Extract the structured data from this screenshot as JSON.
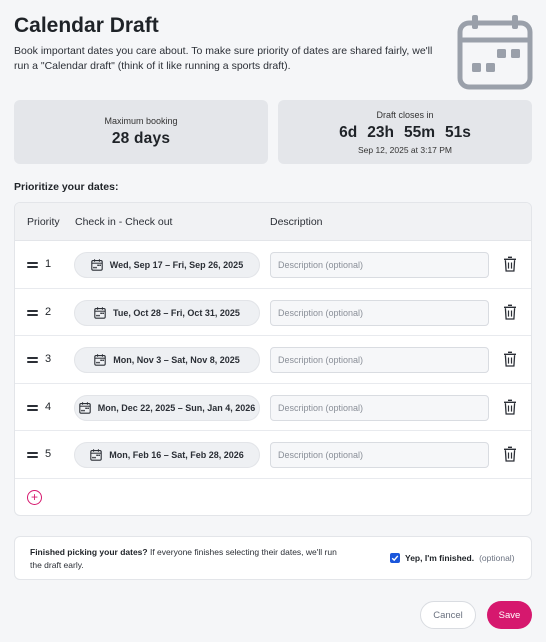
{
  "header": {
    "title": "Calendar Draft",
    "intro": "Book important dates you care about. To make sure priority of dates are shared fairly, we'll run a \"Calendar draft\" (think of it like running a sports draft)."
  },
  "stats": {
    "max_booking_label": "Maximum booking",
    "max_booking_value": "28 days",
    "draft_closes_label": "Draft closes in",
    "countdown": {
      "days": "6d",
      "hours": "23h",
      "minutes": "55m",
      "seconds": "51s"
    },
    "draft_closes_date": "Sep 12, 2025 at 3:17 PM"
  },
  "section_title": "Prioritize your dates:",
  "table": {
    "headers": {
      "priority": "Priority",
      "dates": "Check in - Check out",
      "description": "Description"
    },
    "desc_placeholder": "Description (optional)",
    "rows": [
      {
        "priority": "1",
        "dates": "Wed, Sep 17 – Fri, Sep 26, 2025"
      },
      {
        "priority": "2",
        "dates": "Tue, Oct 28 – Fri, Oct 31, 2025"
      },
      {
        "priority": "3",
        "dates": "Mon, Nov 3 – Sat, Nov 8, 2025"
      },
      {
        "priority": "4",
        "dates": "Mon, Dec 22, 2025 – Sun, Jan 4, 2026"
      },
      {
        "priority": "5",
        "dates": "Mon, Feb 16 – Sat, Feb 28, 2026"
      }
    ],
    "add_icon": "+"
  },
  "finish": {
    "bold": "Finished picking your dates?",
    "text": " If everyone finishes selecting their dates, we'll run the draft early.",
    "checkbox_checked": true,
    "checkbox_label": "Yep, I'm finished.",
    "checkbox_optional": "(optional)"
  },
  "actions": {
    "cancel": "Cancel",
    "save": "Save"
  },
  "colors": {
    "accent": "#d6186e",
    "checkbox": "#1a56db",
    "card": "#e4e6ea",
    "page": "#f5f6f8"
  },
  "icons": [
    "calendar-illustration-icon",
    "calendar-icon",
    "drag-handle-icon",
    "trash-icon",
    "plus-circle-icon",
    "checkmark-icon"
  ]
}
